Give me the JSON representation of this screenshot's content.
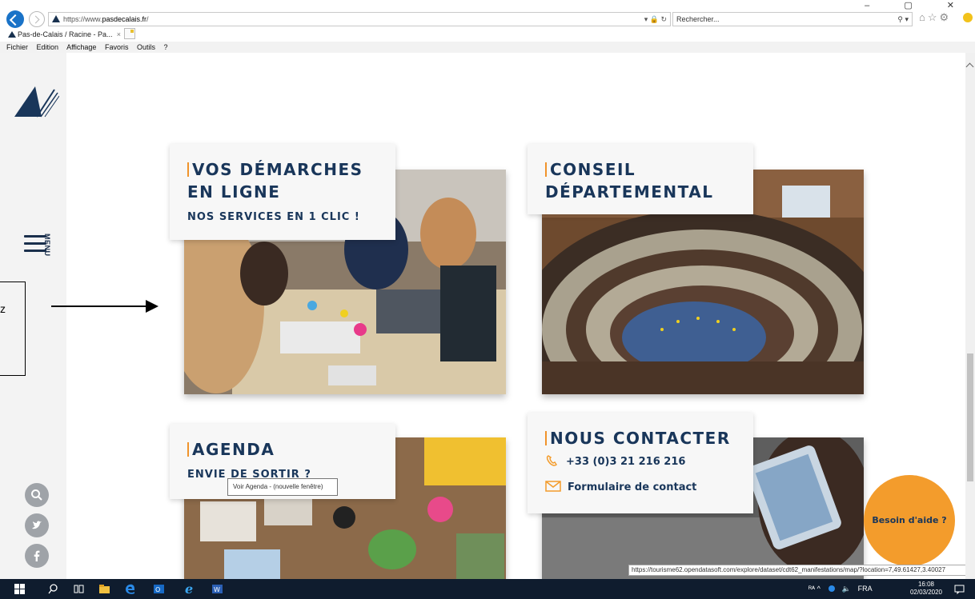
{
  "browser": {
    "url_prefix": "https://www.",
    "url_domain": "pasdecalais.fr",
    "url_suffix": "/",
    "url_tools": "▾ 🔒 ↻",
    "search_placeholder": "Rechercher...",
    "search_tool": "⚲ ▾",
    "tab_title": "Pas-de-Calais / Racine - Pa...",
    "tab_close": "×",
    "menu": [
      "Fichier",
      "Edition",
      "Affichage",
      "Favoris",
      "Outils",
      "?"
    ],
    "window_controls": "– ▢ ✕",
    "toolbar_icons": "⌂☆⚙"
  },
  "sidebar": {
    "menu_label": "MENU",
    "icons": [
      "search-icon",
      "twitter-icon",
      "facebook-icon"
    ]
  },
  "annotation": {
    "letter": "z"
  },
  "cards": {
    "demarches": {
      "title_line1": "VOS DÉMARCHES",
      "title_line2": "EN LIGNE",
      "subtitle": "NOS SERVICES EN 1 CLIC !"
    },
    "conseil": {
      "title_line1": "CONSEIL",
      "title_line2": "DÉPARTEMENTAL"
    },
    "agenda": {
      "title": "AGENDA",
      "subtitle": "ENVIE DE SORTIR ?"
    },
    "contact": {
      "title": "NOUS CONTACTER",
      "phone": "+33 (0)3 21 216 216",
      "form": "Formulaire de contact"
    }
  },
  "tooltip": "Voir Agenda - (nouvelle fenêtre)",
  "help_button": "Besoin d'aide ?",
  "status_url": "https://tourisme62.opendatasoft.com/explore/dataset/cdt62_manifestations/map/?location=7,49.61427,3.40027",
  "taskbar": {
    "tray_text": "ᴿᴬ ^",
    "language": "FRA",
    "time": "16:08",
    "date": "02/03/2020"
  },
  "colors": {
    "brand_navy": "#19365a",
    "accent_orange": "#f39c2c",
    "taskbar": "#0f1c2e"
  }
}
